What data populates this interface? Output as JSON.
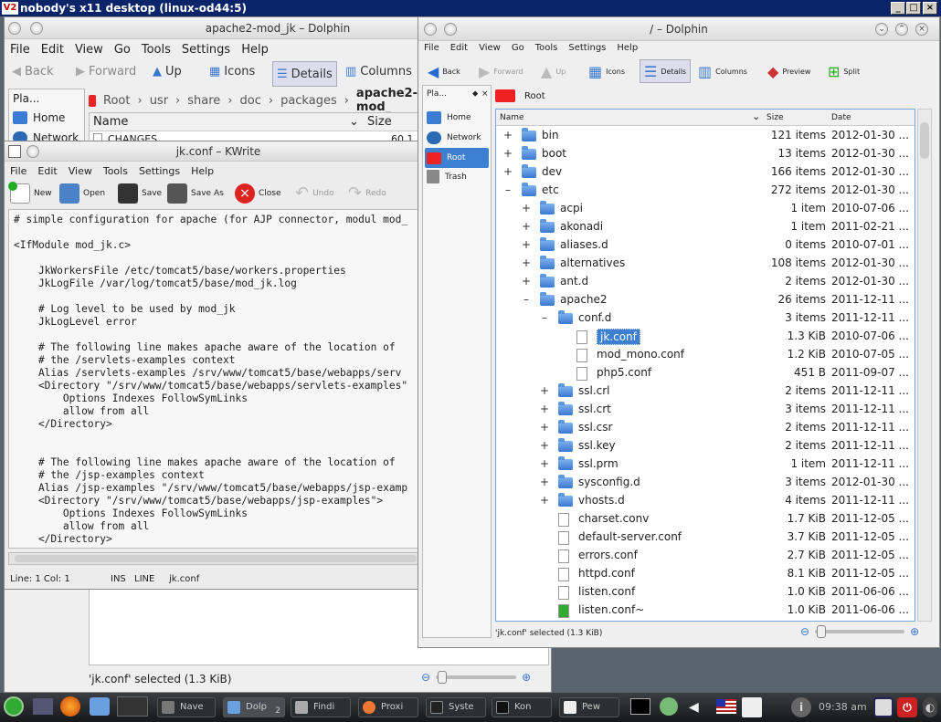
{
  "vnc": {
    "title": "nobody's x11 desktop (linux-od44:5)",
    "logo": "V2"
  },
  "back_dolphin": {
    "title": "apache2-mod_jk – Dolphin",
    "menu": [
      "File",
      "Edit",
      "View",
      "Go",
      "Tools",
      "Settings",
      "Help"
    ],
    "toolbar": {
      "back": "Back",
      "forward": "Forward",
      "up": "Up",
      "icons": "Icons",
      "details": "Details",
      "columns": "Columns"
    },
    "places_title": "Pla...",
    "places": [
      "Home",
      "Network"
    ],
    "breadcrumb": [
      "Root",
      "usr",
      "share",
      "doc",
      "packages",
      "apache2-mod_"
    ],
    "columns": {
      "name": "Name",
      "size": "Size"
    },
    "first_file": {
      "name": "CHANGES",
      "size": "60.1"
    },
    "status": "'jk.conf' selected (1.3 KiB)"
  },
  "kwrite": {
    "title": "jk.conf – KWrite",
    "menu": [
      "File",
      "Edit",
      "View",
      "Tools",
      "Settings",
      "Help"
    ],
    "toolbar": {
      "new": "New",
      "open": "Open",
      "save": "Save",
      "save_as": "Save As",
      "close": "Close",
      "undo": "Undo",
      "redo": "Redo"
    },
    "lines": [
      "# simple configuration for apache (for AJP connector, modul mod_",
      "",
      "<IfModule mod_jk.c>",
      "",
      "    JkWorkersFile /etc/tomcat5/base/workers.properties",
      "    JkLogFile /var/log/tomcat5/base/mod_jk.log",
      "",
      "    # Log level to be used by mod_jk",
      "    JkLogLevel error",
      "",
      "    # The following line makes apache aware of the location of",
      "    # the /servlets-examples context",
      "    Alias /servlets-examples /srv/www/tomcat5/base/webapps/serv",
      "    <Directory \"/srv/www/tomcat5/base/webapps/servlets-examples\"",
      "        Options Indexes FollowSymLinks",
      "        allow from all",
      "    </Directory>",
      "",
      "",
      "    # The following line makes apache aware of the location of",
      "    # the /jsp-examples context",
      "    Alias /jsp-examples \"/srv/www/tomcat5/base/webapps/jsp-examp",
      "    <Directory \"/srv/www/tomcat5/base/webapps/jsp-examples\">",
      "        Options Indexes FollowSymLinks",
      "        allow from all",
      "    </Directory>"
    ],
    "status": {
      "position": "Line: 1 Col: 1",
      "ins": "INS",
      "mode": "LINE",
      "file": "jk.conf"
    }
  },
  "dolphin": {
    "title": "/ – Dolphin",
    "menu": [
      "File",
      "Edit",
      "View",
      "Go",
      "Tools",
      "Settings",
      "Help"
    ],
    "toolbar": {
      "back": "Back",
      "forward": "Forward",
      "up": "Up",
      "icons": "Icons",
      "details": "Details",
      "columns": "Columns",
      "preview": "Preview",
      "split": "Split"
    },
    "places_title": "Pla...",
    "places": [
      "Home",
      "Network",
      "Root",
      "Trash"
    ],
    "breadcrumb": "Root",
    "columns": {
      "name": "Name",
      "size": "Size",
      "date": "Date"
    },
    "rows": [
      {
        "name": "bin",
        "size": "121 items",
        "date": "2012-01-30 ...",
        "depth": 0,
        "exp": "+",
        "type": "folder"
      },
      {
        "name": "boot",
        "size": "13 items",
        "date": "2012-01-30 ...",
        "depth": 0,
        "exp": "+",
        "type": "folder"
      },
      {
        "name": "dev",
        "size": "166 items",
        "date": "2012-01-30 ...",
        "depth": 0,
        "exp": "+",
        "type": "folder"
      },
      {
        "name": "etc",
        "size": "272 items",
        "date": "2012-01-30 ...",
        "depth": 0,
        "exp": "–",
        "type": "folder"
      },
      {
        "name": "acpi",
        "size": "1 item",
        "date": "2010-07-06 ...",
        "depth": 1,
        "exp": "+",
        "type": "folder"
      },
      {
        "name": "akonadi",
        "size": "1 item",
        "date": "2011-02-21 ...",
        "depth": 1,
        "exp": "+",
        "type": "folder"
      },
      {
        "name": "aliases.d",
        "size": "0 items",
        "date": "2010-07-01 ...",
        "depth": 1,
        "exp": "+",
        "type": "folder"
      },
      {
        "name": "alternatives",
        "size": "108 items",
        "date": "2012-01-30 ...",
        "depth": 1,
        "exp": "+",
        "type": "folder"
      },
      {
        "name": "ant.d",
        "size": "2 items",
        "date": "2012-01-30 ...",
        "depth": 1,
        "exp": "+",
        "type": "folder"
      },
      {
        "name": "apache2",
        "size": "26 items",
        "date": "2011-12-11 ...",
        "depth": 1,
        "exp": "–",
        "type": "folder"
      },
      {
        "name": "conf.d",
        "size": "3 items",
        "date": "2011-12-11 ...",
        "depth": 2,
        "exp": "–",
        "type": "folder"
      },
      {
        "name": "jk.conf",
        "size": "1.3 KiB",
        "date": "2010-07-06 ...",
        "depth": 3,
        "exp": "",
        "type": "file",
        "selected": true
      },
      {
        "name": "mod_mono.conf",
        "size": "1.2 KiB",
        "date": "2010-07-05 ...",
        "depth": 3,
        "exp": "",
        "type": "file"
      },
      {
        "name": "php5.conf",
        "size": "451 B",
        "date": "2011-09-07 ...",
        "depth": 3,
        "exp": "",
        "type": "file"
      },
      {
        "name": "ssl.crl",
        "size": "2 items",
        "date": "2011-12-11 ...",
        "depth": 2,
        "exp": "+",
        "type": "folder"
      },
      {
        "name": "ssl.crt",
        "size": "3 items",
        "date": "2011-12-11 ...",
        "depth": 2,
        "exp": "+",
        "type": "folder"
      },
      {
        "name": "ssl.csr",
        "size": "2 items",
        "date": "2011-12-11 ...",
        "depth": 2,
        "exp": "+",
        "type": "folder"
      },
      {
        "name": "ssl.key",
        "size": "2 items",
        "date": "2011-12-11 ...",
        "depth": 2,
        "exp": "+",
        "type": "folder"
      },
      {
        "name": "ssl.prm",
        "size": "1 item",
        "date": "2011-12-11 ...",
        "depth": 2,
        "exp": "+",
        "type": "folder"
      },
      {
        "name": "sysconfig.d",
        "size": "3 items",
        "date": "2012-01-30 ...",
        "depth": 2,
        "exp": "+",
        "type": "folder"
      },
      {
        "name": "vhosts.d",
        "size": "4 items",
        "date": "2011-12-11 ...",
        "depth": 2,
        "exp": "+",
        "type": "folder"
      },
      {
        "name": "charset.conv",
        "size": "1.7 KiB",
        "date": "2011-12-05 ...",
        "depth": 2,
        "exp": "",
        "type": "file"
      },
      {
        "name": "default-server.conf",
        "size": "3.7 KiB",
        "date": "2011-12-05 ...",
        "depth": 2,
        "exp": "",
        "type": "file"
      },
      {
        "name": "errors.conf",
        "size": "2.7 KiB",
        "date": "2011-12-05 ...",
        "depth": 2,
        "exp": "",
        "type": "file"
      },
      {
        "name": "httpd.conf",
        "size": "8.1 KiB",
        "date": "2011-12-05 ...",
        "depth": 2,
        "exp": "",
        "type": "file"
      },
      {
        "name": "listen.conf",
        "size": "1.0 KiB",
        "date": "2011-06-06 ...",
        "depth": 2,
        "exp": "",
        "type": "file"
      },
      {
        "name": "listen.conf~",
        "size": "1.0 KiB",
        "date": "2011-06-06 ...",
        "depth": 2,
        "exp": "",
        "type": "file-green"
      }
    ],
    "status": "'jk.conf' selected (1.3 KiB)"
  },
  "taskbar": {
    "items": [
      "Nave",
      "Dolp",
      "Findi",
      "Proxi",
      "Syste",
      "Kon",
      "Pew"
    ],
    "dolphin_count": "2",
    "clock": "09:38 am"
  }
}
